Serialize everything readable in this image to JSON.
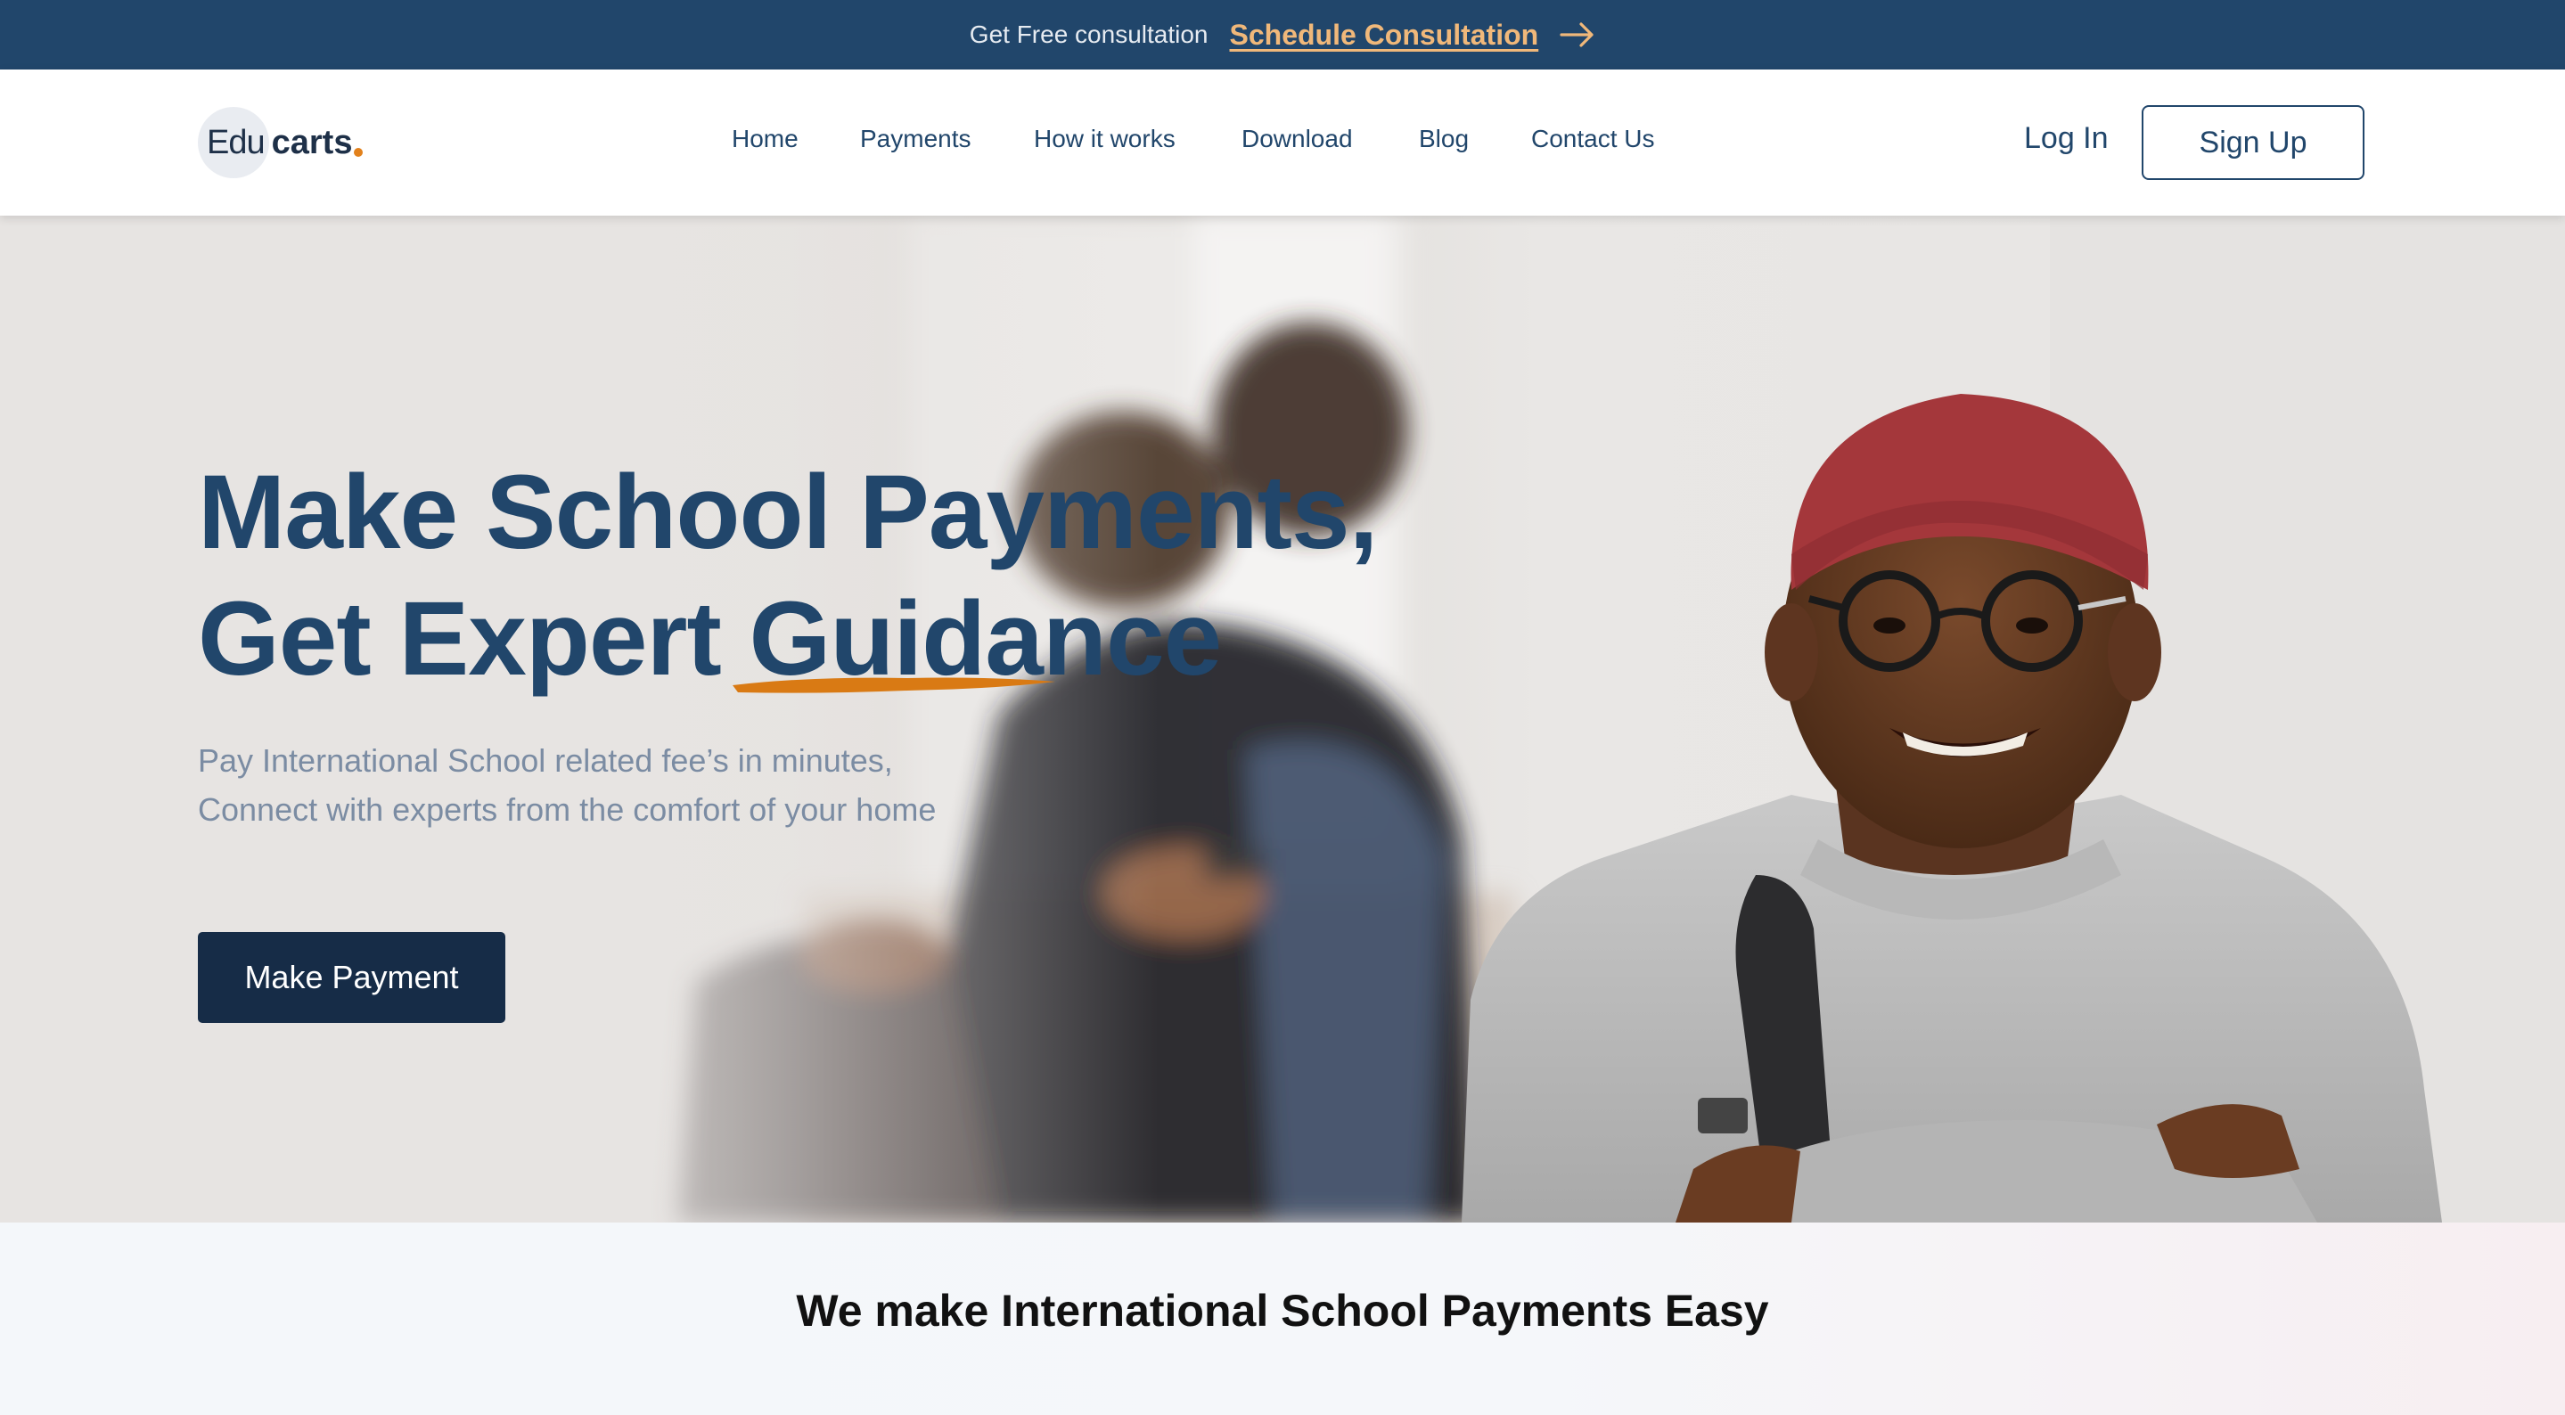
{
  "topbar": {
    "text": "Get Free consultation",
    "link_label": "Schedule Consultation",
    "link_icon": "arrow-right-icon"
  },
  "logo": {
    "part1": "Edu",
    "part2": "carts"
  },
  "nav": {
    "items": [
      "Home",
      "Payments",
      "How it works",
      "Download",
      "Blog",
      "Contact Us"
    ]
  },
  "auth": {
    "login_label": "Log In",
    "signup_label": "Sign Up"
  },
  "hero": {
    "title_line1": "Make School Payments,",
    "title_line2_a": "Get Expert ",
    "title_line2_b": "Guidance",
    "subtitle_line1": "Pay International School related fee’s in minutes,",
    "subtitle_line2": "Connect with experts from the comfort of your home",
    "cta_label": "Make Payment"
  },
  "band": {
    "title": "We make International School Payments Easy"
  },
  "colors": {
    "navy": "#21466b",
    "dark_navy": "#162c47",
    "accent_orange": "#e2811c",
    "link_peach": "#f0b87a",
    "muted_text": "#7b8ca3"
  }
}
